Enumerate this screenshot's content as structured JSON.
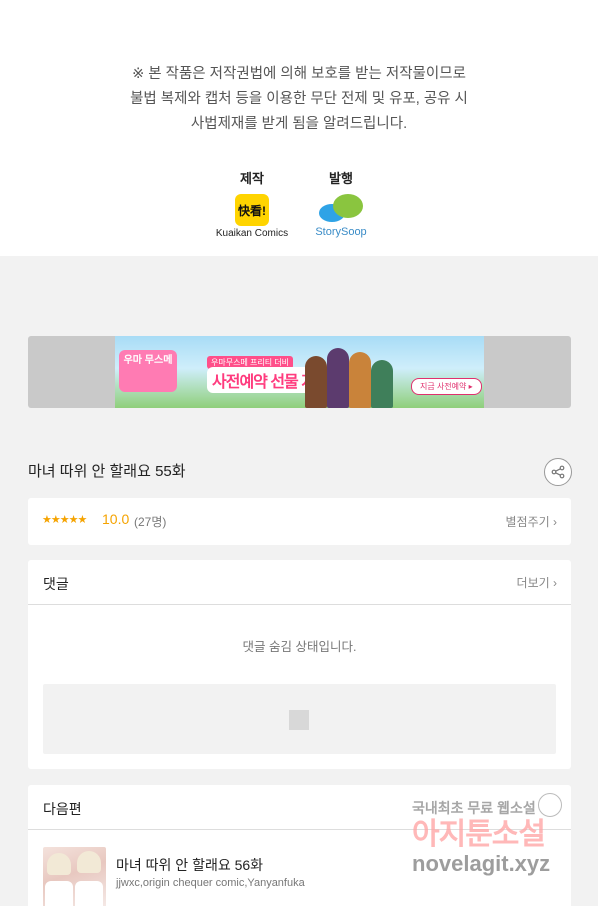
{
  "notice": {
    "lines": [
      "※ 본 작품은 저작권법에 의해 보호를 받는 저작물이므로",
      "불법 복제와 캡처 등을  이용한 무단 전제 및 유포, 공유 시",
      "사법제재를  받게 됨을 알려드립니다."
    ]
  },
  "credits": {
    "produce_label": "제작",
    "produce_logo_text": "快看!",
    "produce_name": "Kuaikan Comics",
    "publish_label": "발행",
    "publish_name": "StorySoop"
  },
  "banner": {
    "logo_text": "우마 무스메",
    "tagline": "우마무스메 프리티 더비",
    "headline": "사전예약 선물 지급!",
    "cta": "지금 사전예약 ▸"
  },
  "episode": {
    "title": "마녀 따위 안 할래요 55화"
  },
  "rating": {
    "stars": "★★★★★",
    "score": "10.0",
    "count": "(27명)",
    "rate_link": "별점주기 ›"
  },
  "comments": {
    "title": "댓글",
    "more": "더보기 ›",
    "hidden_message": "댓글 숨김 상태입니다."
  },
  "next": {
    "title": "다음편",
    "episode_title": "마녀 따위 안 할래요 56화",
    "authors": "jjwxc,origin chequer comic,Yanyanfuka"
  },
  "watermark": {
    "line1": "국내최초 무료 웹소설",
    "line2": "아지툰소설",
    "line3": "novelagit.xyz"
  },
  "colors": {
    "accent_star": "#f5a300",
    "kuaikan_yellow": "#ffd400",
    "background": "#f2f2f2"
  }
}
